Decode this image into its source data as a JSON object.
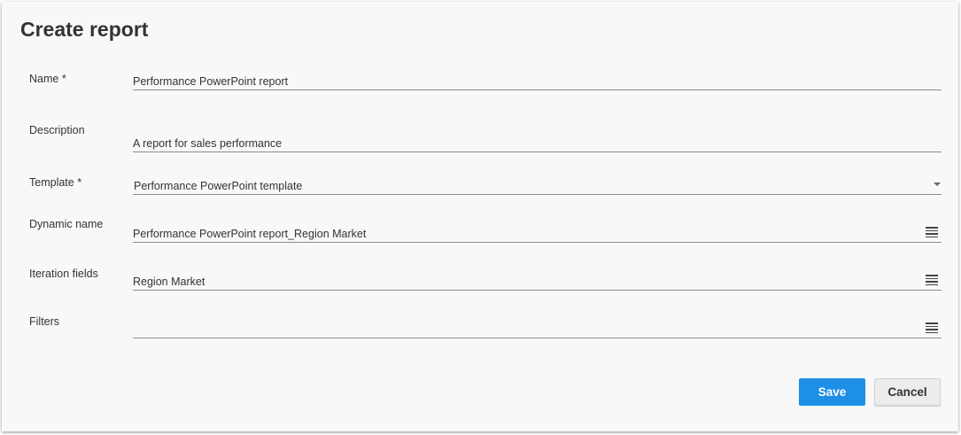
{
  "dialog": {
    "title": "Create report"
  },
  "form": {
    "name": {
      "label": "Name *",
      "value": "Performance PowerPoint report"
    },
    "description": {
      "label": "Description",
      "value": "A report for sales performance"
    },
    "template": {
      "label": "Template *",
      "value": "Performance PowerPoint template"
    },
    "dynamic_name": {
      "label": "Dynamic name",
      "value": "Performance PowerPoint report_Region Market"
    },
    "iteration_fields": {
      "label": "Iteration fields",
      "value": "Region Market"
    },
    "filters": {
      "label": "Filters",
      "value": ""
    }
  },
  "icons": {
    "template_dropdown": "caret-down-icon",
    "dynamic_name_menu": "menu-lines-icon",
    "iteration_fields_menu": "menu-lines-icon",
    "filters_menu": "menu-lines-icon"
  },
  "buttons": {
    "save_label": "Save",
    "cancel_label": "Cancel"
  },
  "colors": {
    "primary": "#1e8fe6",
    "dialog_background": "#f8f8f8"
  }
}
